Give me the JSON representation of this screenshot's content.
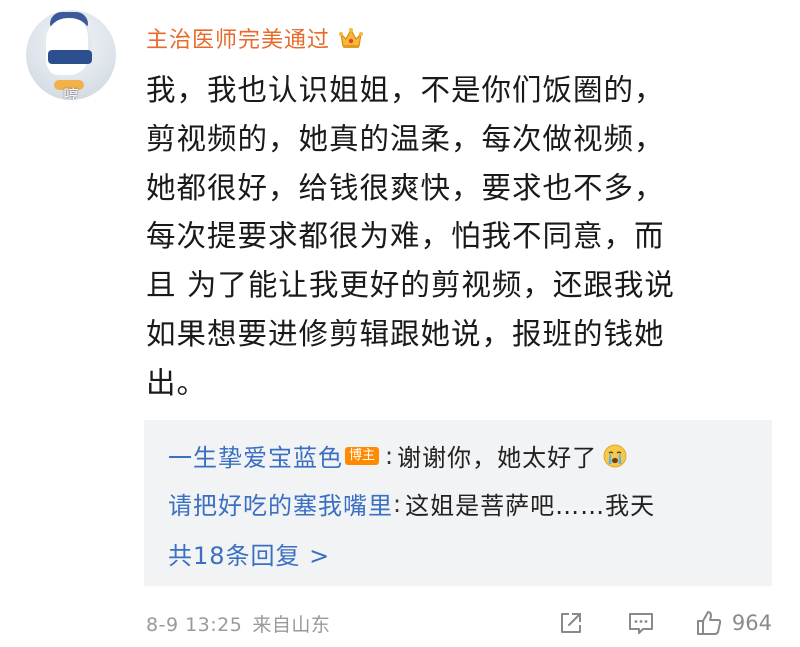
{
  "comment": {
    "avatar_caption": "哼",
    "username": "主治医师完美通过",
    "username_badge_icon": "crown-icon",
    "text_lines": [
      "我，我也认识姐姐，不是你们饭圈的，",
      "剪视频的，她真的温柔，每次做视频，",
      "她都很好，给钱很爽快，要求也不多，",
      "每次提要求都很为难，怕我不同意，而",
      "且 为了能让我更好的剪视频，还跟我说",
      "如果想要进修剪辑跟她说，报班的钱她",
      "出。"
    ]
  },
  "replies": [
    {
      "user": "一生挚爱宝蓝色",
      "badge": "博主",
      "separator": ":",
      "text": "谢谢你，她太好了",
      "emoji_icon": "crying-face-icon"
    },
    {
      "user": "请把好吃的塞我嘴里",
      "separator": ":",
      "text": "这姐是菩萨吧……我天"
    }
  ],
  "more_replies_label": "共18条回复 >",
  "footer": {
    "timestamp": "8-9 13:25",
    "source": "来自山东",
    "like_count": "964"
  },
  "colors": {
    "username": "#e86a2a",
    "reply_user": "#3a6fc2",
    "reply_box_bg": "#f2f3f5",
    "meta": "#9a9a9a"
  }
}
